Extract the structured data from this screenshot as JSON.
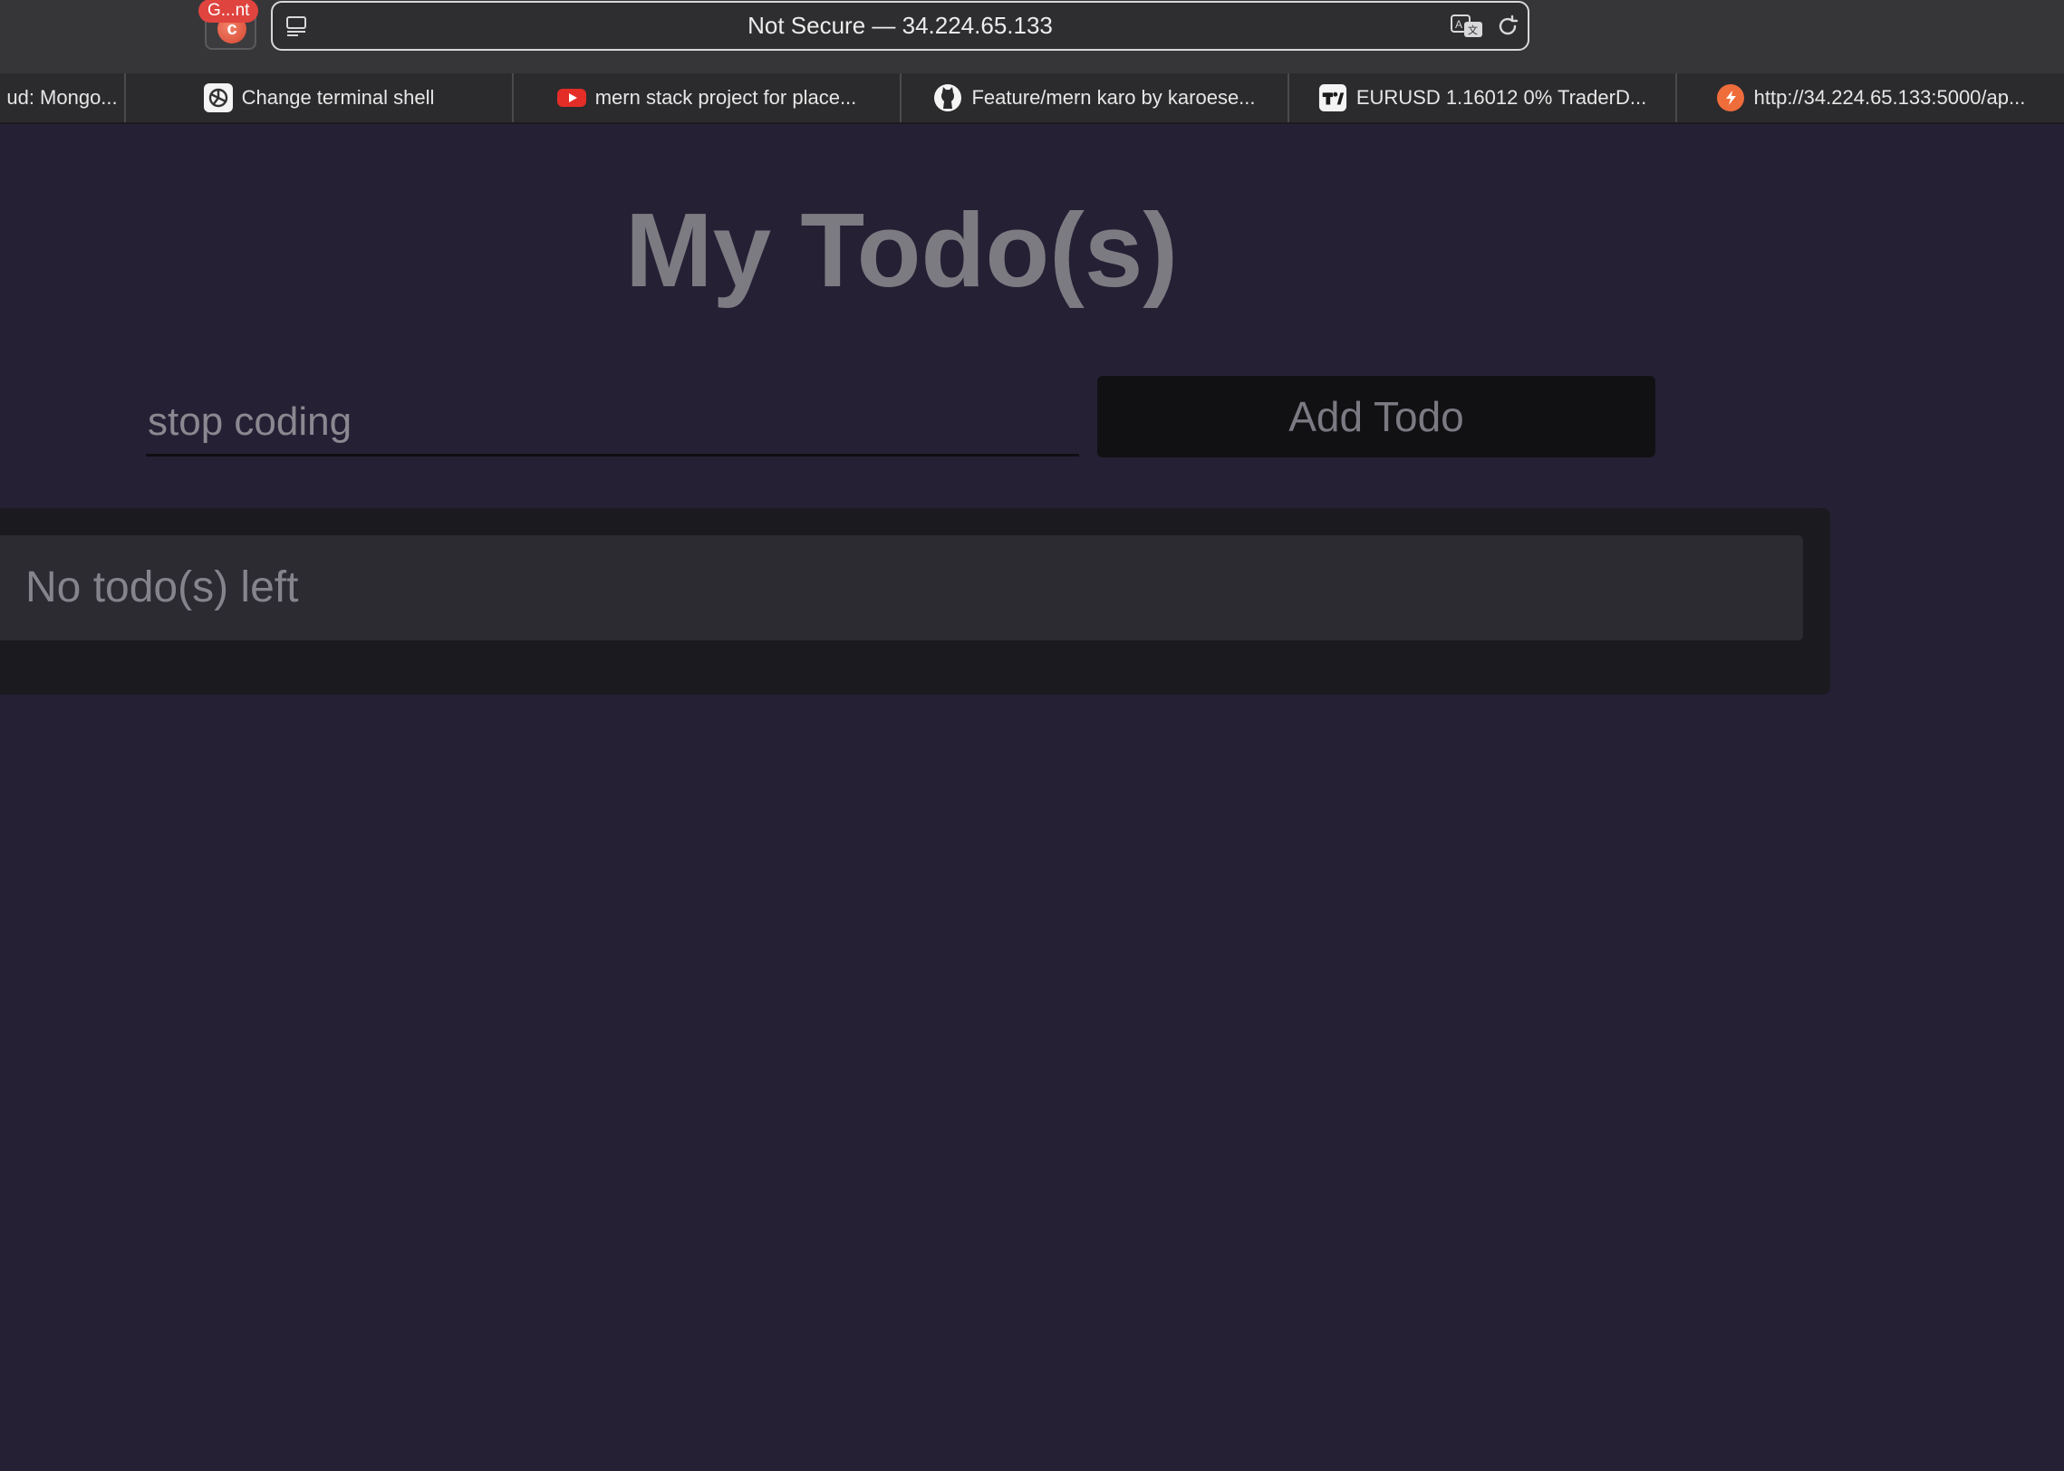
{
  "browser": {
    "extension_badge": "G...nt",
    "address": "Not Secure — 34.224.65.133"
  },
  "tabs": [
    {
      "label": "ud: Mongo...",
      "icon": "mongo-icon"
    },
    {
      "label": "Change terminal shell",
      "icon": "openai-icon"
    },
    {
      "label": "mern stack project for place...",
      "icon": "youtube-icon"
    },
    {
      "label": "Feature/mern karo by karoese...",
      "icon": "github-icon"
    },
    {
      "label": "EURUSD 1.16012 0% TraderD...",
      "icon": "tradingview-icon"
    },
    {
      "label": "http://34.224.65.133:5000/ap...",
      "icon": "postman-icon"
    }
  ],
  "app": {
    "title": "My Todo(s)",
    "input_value": "stop coding",
    "add_button": "Add Todo",
    "empty_message": "No todo(s) left"
  },
  "colors": {
    "page_background": "#262035",
    "panel_background": "#1b1b1f",
    "item_background": "#2b2b31",
    "button_background": "#111114"
  }
}
